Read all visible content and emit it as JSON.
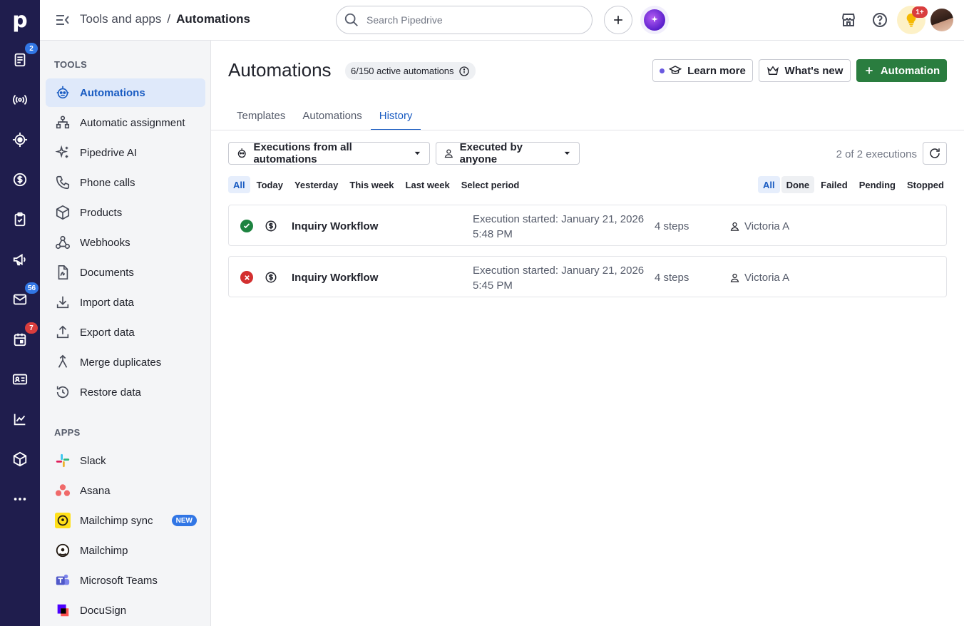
{
  "rail": {
    "logo": "p",
    "items": [
      {
        "name": "leads-icon",
        "badge": "2"
      },
      {
        "name": "broadcast-icon",
        "badge": ""
      },
      {
        "name": "target-icon",
        "badge": ""
      },
      {
        "name": "dollar-icon",
        "badge": ""
      },
      {
        "name": "clipboard-icon",
        "badge": ""
      },
      {
        "name": "megaphone-icon",
        "badge": ""
      },
      {
        "name": "mail-icon",
        "badge": "56"
      },
      {
        "name": "calendar-icon",
        "badge": "7"
      },
      {
        "name": "contacts-icon",
        "badge": ""
      },
      {
        "name": "chart-icon",
        "badge": ""
      },
      {
        "name": "box-icon",
        "badge": ""
      },
      {
        "name": "more-icon",
        "badge": ""
      }
    ]
  },
  "header": {
    "breadcrumb_parent": "Tools and apps",
    "breadcrumb_sep": "/",
    "breadcrumb_current": "Automations",
    "search_placeholder": "Search Pipedrive",
    "notif_badge": "1+"
  },
  "sidebar": {
    "tools_title": "TOOLS",
    "tools": [
      {
        "label": "Automations",
        "active": true
      },
      {
        "label": "Automatic assignment"
      },
      {
        "label": "Pipedrive AI"
      },
      {
        "label": "Phone calls"
      },
      {
        "label": "Products"
      },
      {
        "label": "Webhooks"
      },
      {
        "label": "Documents"
      },
      {
        "label": "Import data"
      },
      {
        "label": "Export data"
      },
      {
        "label": "Merge duplicates"
      },
      {
        "label": "Restore data"
      }
    ],
    "apps_title": "APPS",
    "apps": [
      {
        "label": "Slack"
      },
      {
        "label": "Asana"
      },
      {
        "label": "Mailchimp sync",
        "badge": "NEW"
      },
      {
        "label": "Mailchimp"
      },
      {
        "label": "Microsoft Teams"
      },
      {
        "label": "DocuSign"
      }
    ]
  },
  "main": {
    "title": "Automations",
    "active_count": "6/150 active automations",
    "learn_more": "Learn more",
    "whats_new": "What's new",
    "add_automation": "Automation",
    "tabs": [
      "Templates",
      "Automations",
      "History"
    ],
    "active_tab": "History",
    "filter_automations": "Executions from all automations",
    "filter_owner": "Executed by anyone",
    "exec_count": "2 of 2 executions",
    "period_chips": [
      "All",
      "Today",
      "Yesterday",
      "This week",
      "Last week",
      "Select period"
    ],
    "status_chips": [
      "All",
      "Done",
      "Failed",
      "Pending",
      "Stopped"
    ],
    "executions": [
      {
        "status": "done",
        "name": "Inquiry Workflow",
        "started_line1": "Execution started: January 21, 2026",
        "started_line2": "5:48 PM",
        "steps": "4 steps",
        "owner": "Victoria A"
      },
      {
        "status": "failed",
        "name": "Inquiry Workflow",
        "started_line1": "Execution started: January 21, 2026",
        "started_line2": "5:45 PM",
        "steps": "4 steps",
        "owner": "Victoria A"
      }
    ]
  },
  "colors": {
    "rail": "#1f1d4d",
    "accent": "#1a5cc2",
    "primary_button": "#2a7d3f",
    "success": "#1d8340",
    "danger": "#d32f2f"
  }
}
